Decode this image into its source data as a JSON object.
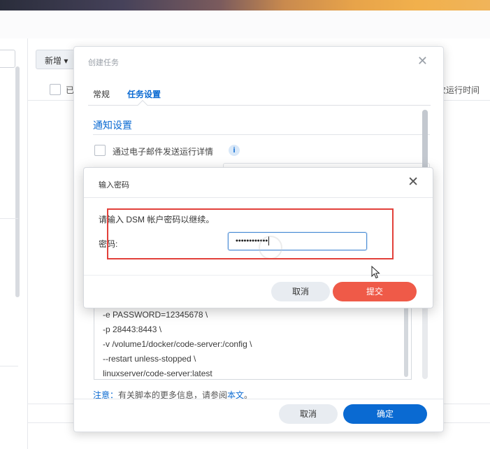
{
  "background": {
    "add_button": "新增",
    "col1_fragment": "已",
    "col2_fragment": "次运行时间"
  },
  "task_dialog": {
    "title": "创建任务",
    "tabs": [
      {
        "label": "常规",
        "active": false
      },
      {
        "label": "任务设置",
        "active": true
      }
    ],
    "section_title": "通知设置",
    "email_option": "通过电子邮件发送运行详情",
    "script_lines": [
      "-e PASSWORD=12345678 \\",
      "-p 28443:8443 \\",
      "-v /volume1/docker/code-server:/config \\",
      "--restart unless-stopped \\",
      "linuxserver/code-server:latest"
    ],
    "note_label": "注意：",
    "note_text": "有关脚本的更多信息，请参阅",
    "note_link": "本文",
    "note_end": "。",
    "cancel_label": "取消",
    "ok_label": "确定"
  },
  "password_dialog": {
    "title": "输入密码",
    "prompt": "请输入 DSM 帐户密码以继续。",
    "password_label": "密码:",
    "password_value": "••••••••••••",
    "cancel_label": "取消",
    "submit_label": "提交"
  },
  "colors": {
    "accent_blue": "#0a6ad2",
    "submit_red": "#ef5a48",
    "highlight_red": "#e2403a"
  }
}
